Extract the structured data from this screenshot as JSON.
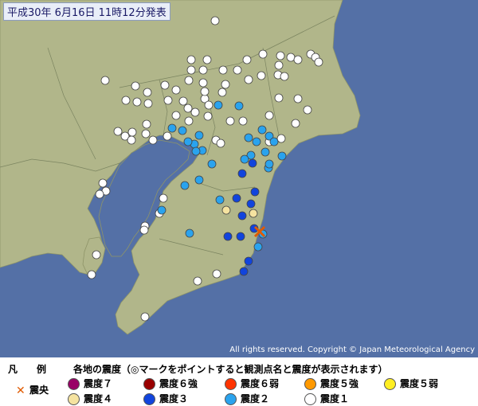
{
  "title": "平成30年 6月16日 11時12分発表",
  "copyright": "All rights reserved. Copyright © Japan Meteorological Agency",
  "legend": {
    "heading": "凡　例",
    "subtitle": "各地の震度（◎マークをポイントすると観測点名と震度が表示されます）",
    "epicenter": "震央",
    "items": [
      {
        "label": "震度７",
        "color": "#990066"
      },
      {
        "label": "震度６強",
        "color": "#990000"
      },
      {
        "label": "震度６弱",
        "color": "#ff3300"
      },
      {
        "label": "震度５強",
        "color": "#ff9900"
      },
      {
        "label": "震度５弱",
        "color": "#ffee22"
      },
      {
        "label": "震度４",
        "color": "#f5e3a0"
      },
      {
        "label": "震度３",
        "color": "#1144dd"
      },
      {
        "label": "震度２",
        "color": "#2aa3ee"
      },
      {
        "label": "震度１",
        "color": "#ffffff"
      }
    ]
  },
  "colors": {
    "sea": "#5470a6",
    "land": "#b1b68a",
    "intensity_4": "#f5e3a0",
    "intensity_3": "#1144dd",
    "intensity_2": "#2aa3ee",
    "intensity_1": "#ffffff",
    "epicenter": "#e05a00"
  },
  "stations": {
    "intensity_4": [
      [
        284,
        264
      ],
      [
        318,
        268
      ]
    ],
    "intensity_3": [
      [
        304,
        218
      ],
      [
        320,
        241
      ],
      [
        297,
        249
      ],
      [
        315,
        256
      ],
      [
        304,
        271
      ],
      [
        286,
        297
      ],
      [
        302,
        297
      ],
      [
        319,
        287
      ],
      [
        312,
        328
      ],
      [
        306,
        341
      ],
      [
        317,
        205
      ]
    ],
    "intensity_2": [
      [
        274,
        132
      ],
      [
        300,
        133
      ],
      [
        329,
        163
      ],
      [
        312,
        173
      ],
      [
        322,
        178
      ],
      [
        338,
        171
      ],
      [
        344,
        178
      ],
      [
        354,
        196
      ],
      [
        333,
        191
      ],
      [
        337,
        211
      ],
      [
        315,
        195
      ],
      [
        307,
        200
      ],
      [
        266,
        206
      ],
      [
        244,
        181
      ],
      [
        254,
        189
      ],
      [
        246,
        190
      ],
      [
        236,
        178
      ],
      [
        229,
        164
      ],
      [
        216,
        161
      ],
      [
        250,
        170
      ],
      [
        250,
        226
      ],
      [
        232,
        233
      ],
      [
        276,
        251
      ],
      [
        238,
        293
      ],
      [
        324,
        310
      ],
      [
        338,
        206
      ],
      [
        203,
        264
      ],
      [
        330,
        294
      ]
    ],
    "intensity_1": [
      [
        270,
        26
      ],
      [
        240,
        75
      ],
      [
        260,
        75
      ],
      [
        240,
        88
      ],
      [
        255,
        88
      ],
      [
        280,
        88
      ],
      [
        298,
        88
      ],
      [
        310,
        75
      ],
      [
        330,
        68
      ],
      [
        352,
        70
      ],
      [
        365,
        72
      ],
      [
        374,
        75
      ],
      [
        390,
        68
      ],
      [
        396,
        72
      ],
      [
        400,
        78
      ],
      [
        350,
        82
      ],
      [
        349,
        94
      ],
      [
        357,
        96
      ],
      [
        328,
        95
      ],
      [
        312,
        100
      ],
      [
        283,
        106
      ],
      [
        255,
        104
      ],
      [
        237,
        101
      ],
      [
        221,
        113
      ],
      [
        207,
        107
      ],
      [
        170,
        108
      ],
      [
        185,
        116
      ],
      [
        132,
        101
      ],
      [
        158,
        126
      ],
      [
        172,
        128
      ],
      [
        186,
        130
      ],
      [
        148,
        165
      ],
      [
        157,
        171
      ],
      [
        166,
        166
      ],
      [
        165,
        176
      ],
      [
        184,
        156
      ],
      [
        183,
        168
      ],
      [
        192,
        176
      ],
      [
        211,
        126
      ],
      [
        230,
        127
      ],
      [
        257,
        124
      ],
      [
        262,
        132
      ],
      [
        236,
        136
      ],
      [
        257,
        115
      ],
      [
        279,
        116
      ],
      [
        289,
        152
      ],
      [
        305,
        152
      ],
      [
        338,
        145
      ],
      [
        350,
        123
      ],
      [
        374,
        124
      ],
      [
        386,
        138
      ],
      [
        371,
        155
      ],
      [
        353,
        174
      ],
      [
        338,
        178
      ],
      [
        271,
        176
      ],
      [
        277,
        180
      ],
      [
        261,
        146
      ],
      [
        245,
        141
      ],
      [
        221,
        145
      ],
      [
        210,
        171
      ],
      [
        237,
        152
      ],
      [
        133,
        240
      ],
      [
        125,
        244
      ],
      [
        129,
        230
      ],
      [
        205,
        249
      ],
      [
        200,
        268
      ],
      [
        182,
        284
      ],
      [
        181,
        289
      ],
      [
        121,
        320
      ],
      [
        115,
        345
      ],
      [
        248,
        353
      ],
      [
        272,
        344
      ],
      [
        182,
        398
      ]
    ]
  },
  "epicenter": [
    [
      326,
      291
    ]
  ]
}
